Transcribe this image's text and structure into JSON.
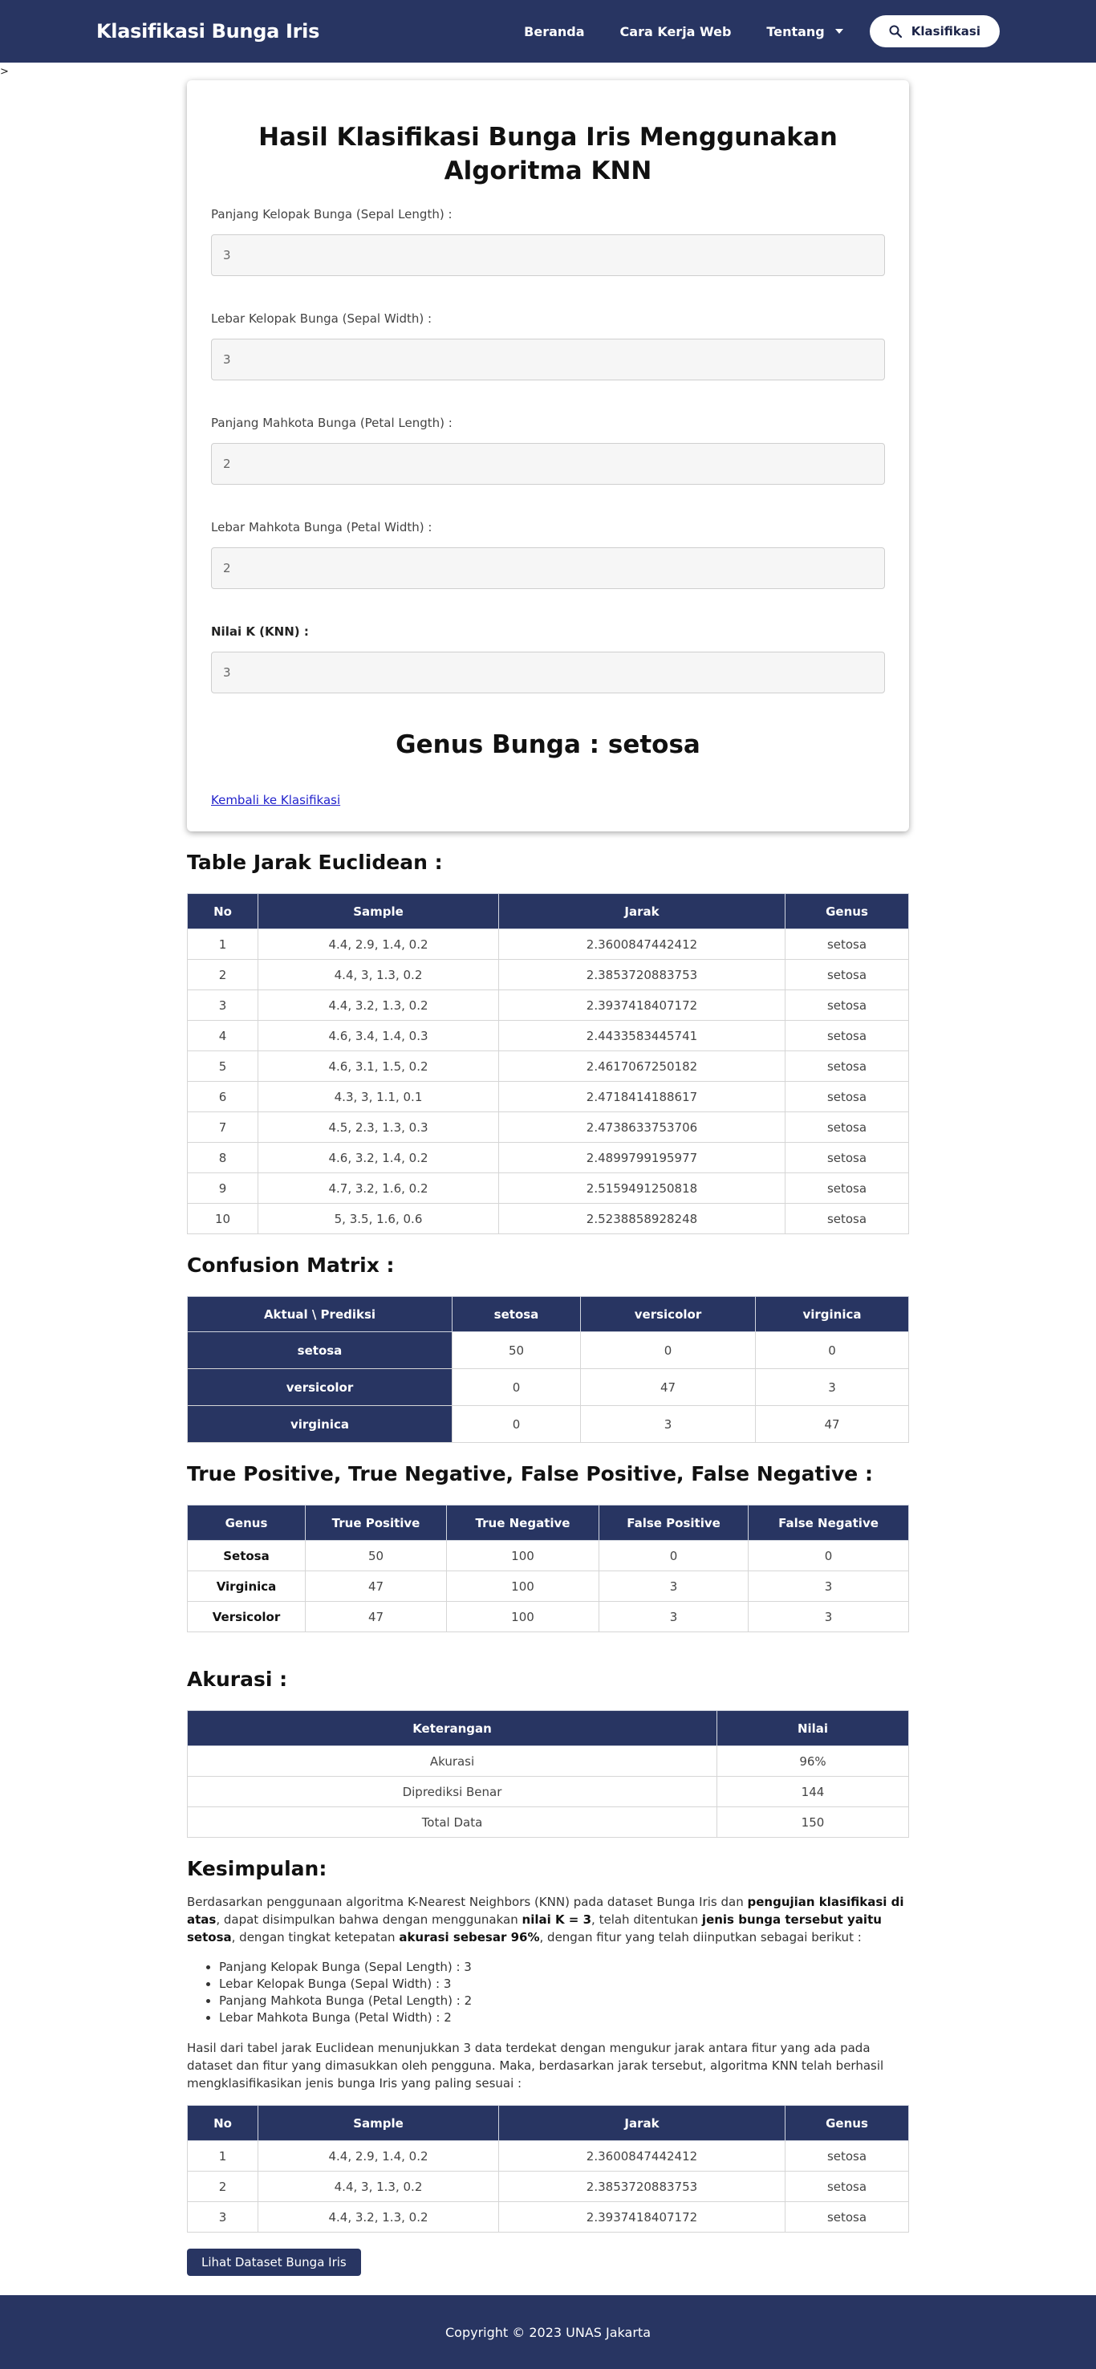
{
  "nav": {
    "brand": "Klasifikasi Bunga Iris",
    "links": [
      "Beranda",
      "Cara Kerja Web",
      "Tentang"
    ],
    "search_button": "Klasifikasi"
  },
  "stray_text": ">",
  "form": {
    "title": "Hasil Klasifikasi Bunga Iris Menggunakan Algoritma KNN",
    "fields": [
      {
        "label": "Panjang Kelopak Bunga (Sepal Length) :",
        "value": "3"
      },
      {
        "label": "Lebar Kelopak Bunga (Sepal Width) :",
        "value": "3"
      },
      {
        "label": "Panjang Mahkota Bunga (Petal Length) :",
        "value": "2"
      },
      {
        "label": "Lebar Mahkota Bunga (Petal Width) :",
        "value": "2"
      },
      {
        "label": "Nilai K (KNN) :",
        "value": "3"
      }
    ],
    "result": "Genus Bunga : setosa",
    "back_link": "Kembali ke Klasifikasi"
  },
  "euclid": {
    "title": "Table Jarak Euclidean :",
    "headers": [
      "No",
      "Sample",
      "Jarak",
      "Genus"
    ],
    "rows": [
      [
        "1",
        "4.4, 2.9, 1.4, 0.2",
        "2.3600847442412",
        "setosa"
      ],
      [
        "2",
        "4.4, 3, 1.3, 0.2",
        "2.3853720883753",
        "setosa"
      ],
      [
        "3",
        "4.4, 3.2, 1.3, 0.2",
        "2.3937418407172",
        "setosa"
      ],
      [
        "4",
        "4.6, 3.4, 1.4, 0.3",
        "2.4433583445741",
        "setosa"
      ],
      [
        "5",
        "4.6, 3.1, 1.5, 0.2",
        "2.4617067250182",
        "setosa"
      ],
      [
        "6",
        "4.3, 3, 1.1, 0.1",
        "2.4718414188617",
        "setosa"
      ],
      [
        "7",
        "4.5, 2.3, 1.3, 0.3",
        "2.4738633753706",
        "setosa"
      ],
      [
        "8",
        "4.6, 3.2, 1.4, 0.2",
        "2.4899799195977",
        "setosa"
      ],
      [
        "9",
        "4.7, 3.2, 1.6, 0.2",
        "2.5159491250818",
        "setosa"
      ],
      [
        "10",
        "5, 3.5, 1.6, 0.6",
        "2.5238858928248",
        "setosa"
      ]
    ]
  },
  "confusion": {
    "title": "Confusion Matrix :",
    "headers": [
      "Aktual \\ Prediksi",
      "setosa",
      "versicolor",
      "virginica"
    ],
    "rows": [
      [
        "setosa",
        "50",
        "0",
        "0"
      ],
      [
        "versicolor",
        "0",
        "47",
        "3"
      ],
      [
        "virginica",
        "0",
        "3",
        "47"
      ]
    ]
  },
  "tptn": {
    "title": "True Positive, True Negative, False Positive, False Negative :",
    "headers": [
      "Genus",
      "True Positive",
      "True Negative",
      "False Positive",
      "False Negative"
    ],
    "rows": [
      [
        "Setosa",
        "50",
        "100",
        "0",
        "0"
      ],
      [
        "Virginica",
        "47",
        "100",
        "3",
        "3"
      ],
      [
        "Versicolor",
        "47",
        "100",
        "3",
        "3"
      ]
    ]
  },
  "accuracy": {
    "title": "Akurasi :",
    "headers": [
      "Keterangan",
      "Nilai"
    ],
    "rows": [
      [
        "Akurasi",
        "96%"
      ],
      [
        "Diprediksi Benar",
        "144"
      ],
      [
        "Total Data",
        "150"
      ]
    ]
  },
  "conclusion": {
    "title": "Kesimpulan:",
    "p1": [
      {
        "t": "Berdasarkan penggunaan algoritma K-Nearest Neighbors (KNN) pada dataset Bunga Iris dan ",
        "b": false
      },
      {
        "t": "pengujian klasifikasi di atas",
        "b": true
      },
      {
        "t": ", dapat disimpulkan bahwa dengan menggunakan ",
        "b": false
      },
      {
        "t": "nilai K = 3",
        "b": true
      },
      {
        "t": ", telah ditentukan ",
        "b": false
      },
      {
        "t": "jenis bunga tersebut yaitu setosa",
        "b": true
      },
      {
        "t": ", dengan tingkat ketepatan ",
        "b": false
      },
      {
        "t": "akurasi sebesar 96%",
        "b": true
      },
      {
        "t": ", dengan fitur yang telah diinputkan sebagai berikut :",
        "b": false
      }
    ],
    "list": [
      "Panjang Kelopak Bunga (Sepal Length) : 3",
      "Lebar Kelopak Bunga (Sepal Width) : 3",
      "Panjang Mahkota Bunga (Petal Length) : 2",
      "Lebar Mahkota Bunga (Petal Width) : 2"
    ],
    "p2": "Hasil dari tabel jarak Euclidean menunjukkan 3 data terdekat dengan mengukur jarak antara fitur yang ada pada dataset dan fitur yang dimasukkan oleh pengguna. Maka, berdasarkan jarak tersebut, algoritma KNN telah berhasil mengklasifikasikan jenis bunga Iris yang paling sesuai :",
    "headers": [
      "No",
      "Sample",
      "Jarak",
      "Genus"
    ],
    "rows": [
      [
        "1",
        "4.4, 2.9, 1.4, 0.2",
        "2.3600847442412",
        "setosa"
      ],
      [
        "2",
        "4.4, 3, 1.3, 0.2",
        "2.3853720883753",
        "setosa"
      ],
      [
        "3",
        "4.4, 3.2, 1.3, 0.2",
        "2.3937418407172",
        "setosa"
      ]
    ],
    "dataset_button": "Lihat Dataset Bunga Iris"
  },
  "footer": "Copyright © 2023 UNAS Jakarta"
}
